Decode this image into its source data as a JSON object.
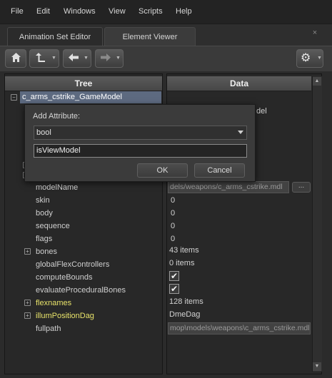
{
  "menu": [
    "File",
    "Edit",
    "Windows",
    "View",
    "Scripts",
    "Help"
  ],
  "tabs": [
    {
      "label": "Animation Set Editor",
      "active": false
    },
    {
      "label": "Element Viewer",
      "active": true
    }
  ],
  "tab_close_glyph": "×",
  "toolbar": {
    "home_icon": "home-icon",
    "up_icon": "up-arrow-icon",
    "back_icon": "back-arrow-icon",
    "forward_icon": "forward-arrow-icon",
    "settings_icon": "gear-icon"
  },
  "tree": {
    "header": "Tree",
    "root": "c_arms_cstrike_GameModel",
    "rows": [
      "modelName",
      "skin",
      "body",
      "sequence",
      "flags",
      "bones",
      "globalFlexControllers",
      "computeBounds",
      "evaluateProceduralBones",
      "flexnames",
      "illumPositionDag",
      "fullpath"
    ]
  },
  "data": {
    "header": "Data",
    "partial_visible": "del",
    "model_name_value": "dels/weapons/c_arms_cstrike.mdl",
    "browse_label": "...",
    "skin": "0",
    "body": "0",
    "sequence": "0",
    "flags": "0",
    "bones": "43 items",
    "global_flex_controllers": "0 items",
    "compute_bounds_checked": true,
    "evaluate_procedural_bones_checked": true,
    "flexnames": "128 items",
    "illum_position_dag": "DmeDag",
    "fullpath": "mop\\models\\weapons\\c_arms_cstrike.mdl"
  },
  "dialog": {
    "title": "Add Attribute:",
    "type_selected": "bool",
    "name_value": "isViewModel",
    "ok_label": "OK",
    "cancel_label": "Cancel"
  },
  "colors": {
    "selection": "#5d6a80",
    "highlight_text": "#e8e36a"
  }
}
